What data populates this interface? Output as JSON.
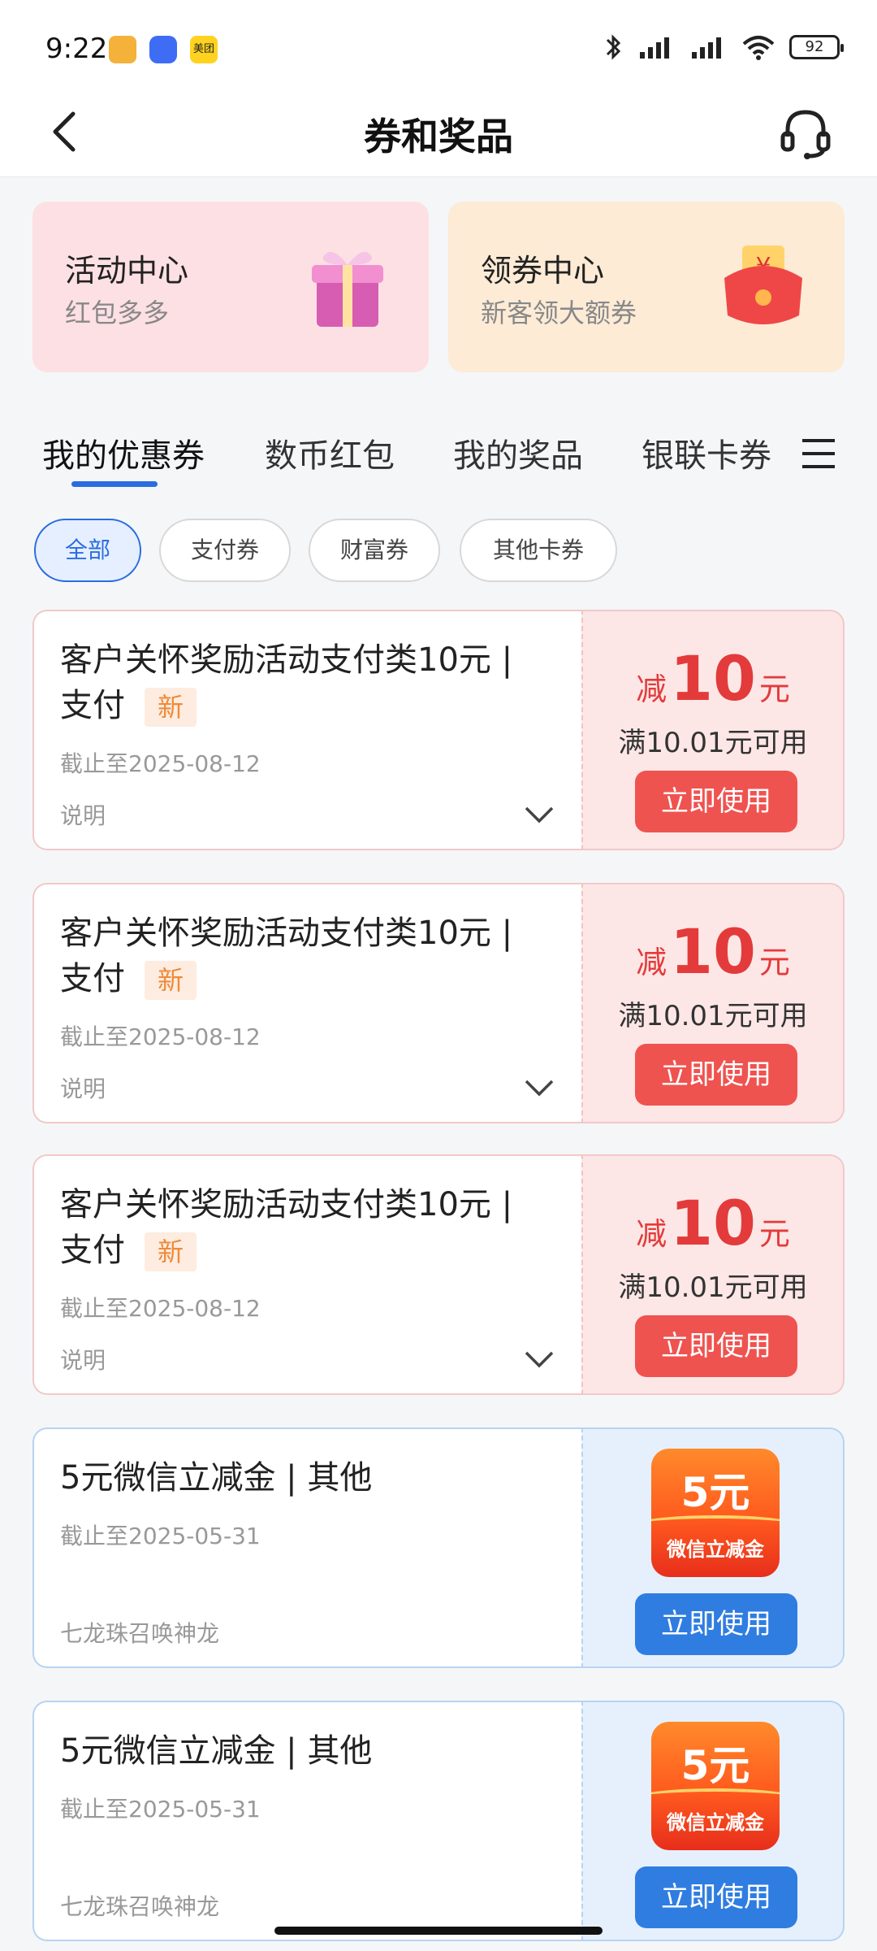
{
  "status": {
    "time": "9:22",
    "apps": [
      "美团"
    ],
    "battery": "92"
  },
  "header": {
    "title": "券和奖品"
  },
  "top_cards": [
    {
      "title": "活动中心",
      "subtitle": "红包多多"
    },
    {
      "title": "领券中心",
      "subtitle": "新客领大额券"
    }
  ],
  "tabs": [
    "我的优惠券",
    "数币红包",
    "我的奖品",
    "银联卡券"
  ],
  "chips": [
    "全部",
    "支付券",
    "财富券",
    "其他卡券"
  ],
  "coupons": [
    {
      "title": "客户关怀奖励活动支付类10元 | 支付",
      "tag": "新",
      "expiry": "截止至2025-08-12",
      "desc": "说明",
      "prefix": "减",
      "amount": "10",
      "unit": "元",
      "condition": "满10.01元可用",
      "button": "立即使用"
    },
    {
      "title": "客户关怀奖励活动支付类10元 | 支付",
      "tag": "新",
      "expiry": "截止至2025-08-12",
      "desc": "说明",
      "prefix": "减",
      "amount": "10",
      "unit": "元",
      "condition": "满10.01元可用",
      "button": "立即使用"
    },
    {
      "title": "客户关怀奖励活动支付类10元 | 支付",
      "tag": "新",
      "expiry": "截止至2025-08-12",
      "desc": "说明",
      "prefix": "减",
      "amount": "10",
      "unit": "元",
      "condition": "满10.01元可用",
      "button": "立即使用"
    },
    {
      "title": "5元微信立减金 | 其他",
      "expiry": "截止至2025-05-31",
      "desc": "七龙珠召唤神龙",
      "badge_amount": "5元",
      "badge_label": "微信立减金",
      "button": "立即使用"
    },
    {
      "title": "5元微信立减金 | 其他",
      "expiry": "截止至2025-05-31",
      "desc": "七龙珠召唤神龙",
      "badge_amount": "5元",
      "badge_label": "微信立减金",
      "button": "立即使用"
    }
  ],
  "colors": {
    "accent_blue": "#2a6de0",
    "coupon_red": "#e33b3b",
    "button_red": "#ef5350",
    "button_blue": "#2f7de1"
  }
}
